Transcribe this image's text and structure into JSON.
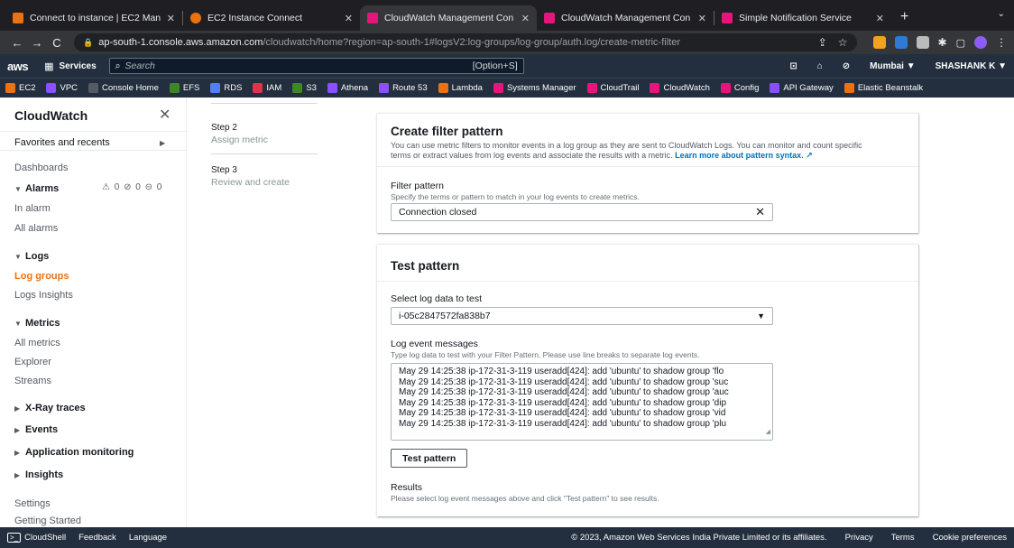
{
  "browser": {
    "tabs": [
      {
        "label": "Connect to instance | EC2 Man",
        "color": "#ec7211",
        "active": false
      },
      {
        "label": "EC2 Instance Connect",
        "color": "#ec7211",
        "active": false
      },
      {
        "label": "CloudWatch Management Con",
        "color": "#e7157b",
        "active": true
      },
      {
        "label": "CloudWatch Management Con",
        "color": "#e7157b",
        "active": false
      },
      {
        "label": "Simple Notification Service",
        "color": "#e7157b",
        "active": false
      }
    ],
    "url_host": "ap-south-1.console.aws.amazon.com",
    "url_path": "/cloudwatch/home?region=ap-south-1#logsV2:log-groups/log-group/auth.log/create-metric-filter"
  },
  "awsnav": {
    "logo": "aws",
    "services": "Services",
    "search_placeholder": "Search",
    "search_hint": "[Option+S]",
    "region": "Mumbai ▼",
    "user": "SHASHANK K ▼"
  },
  "favorites": [
    "EC2",
    "VPC",
    "Console Home",
    "EFS",
    "RDS",
    "IAM",
    "S3",
    "Athena",
    "Route 53",
    "Lambda",
    "Systems Manager",
    "CloudTrail",
    "CloudWatch",
    "Config",
    "API Gateway",
    "Elastic Beanstalk"
  ],
  "sidebar": {
    "title": "CloudWatch",
    "favorites": "Favorites and recents",
    "dashboards": "Dashboards",
    "alarms": "Alarms",
    "alarm_counts": "⚠ 0 ⊘ 0 ⊝ 0",
    "in_alarm": "In alarm",
    "all_alarms": "All alarms",
    "logs": "Logs",
    "log_groups": "Log groups",
    "logs_insights": "Logs Insights",
    "metrics": "Metrics",
    "all_metrics": "All metrics",
    "explorer": "Explorer",
    "streams": "Streams",
    "xray": "X-Ray traces",
    "events": "Events",
    "app_monitoring": "Application monitoring",
    "insights": "Insights",
    "settings": "Settings",
    "getting_started": "Getting Started"
  },
  "steps": {
    "step2_label": "Step 2",
    "step2_title": "Assign metric",
    "step3_label": "Step 3",
    "step3_title": "Review and create"
  },
  "filter_panel": {
    "title": "Create filter pattern",
    "desc1": "You can use metric filters to monitor events in a log group as they are sent to CloudWatch Logs. You can monitor and count specific",
    "desc2": "terms or extract values from log events and associate the results with a metric.",
    "learn_more": "Learn more about pattern syntax.",
    "field_label": "Filter pattern",
    "field_desc": "Specify the terms or pattern to match in your log events to create metrics.",
    "field_value": "Connection closed"
  },
  "test_panel": {
    "title": "Test pattern",
    "select_label": "Select log data to test",
    "select_value": "i-05c2847572fa838b7",
    "messages_label": "Log event messages",
    "messages_desc": "Type log data to test with your Filter Pattern. Please use line breaks to separate log events.",
    "messages": [
      "May 29 14:25:38 ip-172-31-3-119 useradd[424]: add 'ubuntu' to shadow group 'flo",
      "May 29 14:25:38 ip-172-31-3-119 useradd[424]: add 'ubuntu' to shadow group 'suc",
      "May 29 14:25:38 ip-172-31-3-119 useradd[424]: add 'ubuntu' to shadow group 'auc",
      "May 29 14:25:38 ip-172-31-3-119 useradd[424]: add 'ubuntu' to shadow group 'dip",
      "May 29 14:25:38 ip-172-31-3-119 useradd[424]: add 'ubuntu' to shadow group 'vid",
      "May 29 14:25:38 ip-172-31-3-119 useradd[424]: add 'ubuntu' to shadow group 'plu"
    ],
    "button": "Test pattern",
    "results_label": "Results",
    "results_desc": "Please select log event messages above and click \"Test pattern\" to see results."
  },
  "footer": {
    "cloudshell": "CloudShell",
    "feedback": "Feedback",
    "language": "Language",
    "copyright": "© 2023, Amazon Web Services India Private Limited or its affiliates.",
    "privacy": "Privacy",
    "terms": "Terms",
    "cookies": "Cookie preferences"
  }
}
